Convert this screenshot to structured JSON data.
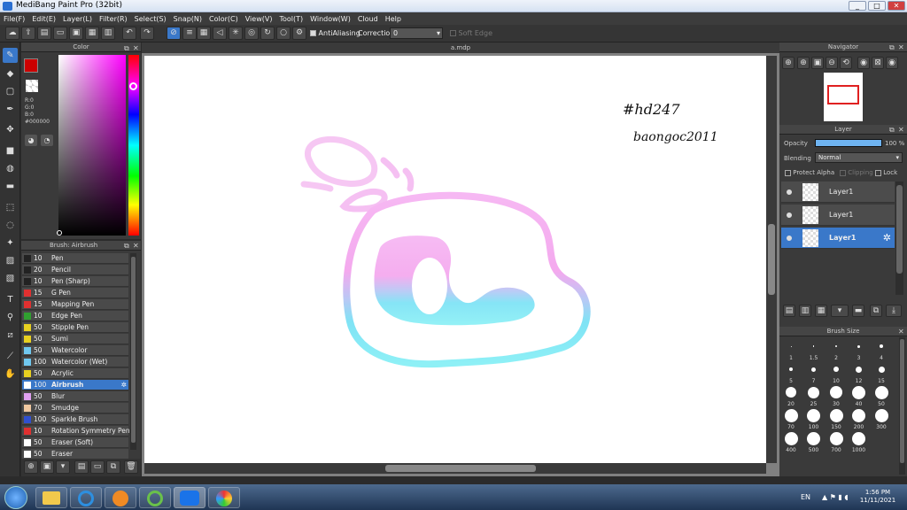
{
  "window": {
    "title": "MediBang Paint Pro (32bit)",
    "min": "_",
    "max": "□",
    "close": "✕"
  },
  "menu": [
    "File(F)",
    "Edit(E)",
    "Layer(L)",
    "Filter(R)",
    "Select(S)",
    "Snap(N)",
    "Color(C)",
    "View(V)",
    "Tool(T)",
    "Window(W)",
    "Cloud",
    "Help"
  ],
  "toolbar": {
    "antialiasing_label": "AntiAliasing",
    "correction_label": "Correction",
    "correction_value": "0",
    "soft_edge_label": "Soft Edge"
  },
  "color_panel": {
    "title": "Color",
    "r": "R:0",
    "g": "G:0",
    "b": "B:0",
    "hex": "#000000",
    "fg": "#cc0000",
    "bg": "#f08080"
  },
  "brush_panel": {
    "title": "Brush: Airbrush",
    "items": [
      {
        "size": "10",
        "name": "Pen",
        "color": "#222222"
      },
      {
        "size": "20",
        "name": "Pencil",
        "color": "#222222"
      },
      {
        "size": "10",
        "name": "Pen (Sharp)",
        "color": "#222222"
      },
      {
        "size": "15",
        "name": "G Pen",
        "color": "#e03030"
      },
      {
        "size": "15",
        "name": "Mapping Pen",
        "color": "#e03030"
      },
      {
        "size": "10",
        "name": "Edge Pen",
        "color": "#30a030"
      },
      {
        "size": "50",
        "name": "Stipple Pen",
        "color": "#e8d020"
      },
      {
        "size": "50",
        "name": "Sumi",
        "color": "#e8d020"
      },
      {
        "size": "50",
        "name": "Watercolor",
        "color": "#70c8f0"
      },
      {
        "size": "100",
        "name": "Watercolor (Wet)",
        "color": "#70c8f0"
      },
      {
        "size": "50",
        "name": "Acrylic",
        "color": "#e8d020"
      },
      {
        "size": "100",
        "name": "Airbrush",
        "color": "#ffffff",
        "selected": true
      },
      {
        "size": "50",
        "name": "Blur",
        "color": "#e0a0f0"
      },
      {
        "size": "70",
        "name": "Smudge",
        "color": "#f0c8a0"
      },
      {
        "size": "100",
        "name": "Sparkle Brush",
        "color": "#3050d0"
      },
      {
        "size": "10",
        "name": "Rotation Symmetry Pen",
        "color": "#e03030"
      },
      {
        "size": "50",
        "name": "Eraser (Soft)",
        "color": "#ffffff"
      },
      {
        "size": "50",
        "name": "Eraser",
        "color": "#ffffff"
      }
    ]
  },
  "document": {
    "tab": "a.mdp",
    "text1": "#hd247",
    "text2": "baongoc2011",
    "glyph": "@"
  },
  "navigator": {
    "title": "Navigator"
  },
  "layer_panel": {
    "title": "Layer",
    "opacity_label": "Opacity",
    "opacity_value": "100 %",
    "opacity_fraction": 1.0,
    "blending_label": "Blending",
    "blending_value": "Normal",
    "protect_alpha": "Protect Alpha",
    "clipping": "Clipping",
    "lock": "Lock",
    "layers": [
      {
        "name": "Layer1",
        "selected": false
      },
      {
        "name": "Layer1",
        "selected": false
      },
      {
        "name": "Layer1",
        "selected": true
      }
    ]
  },
  "brush_size": {
    "title": "Brush Size",
    "sizes": [
      "1",
      "1.5",
      "2",
      "3",
      "4",
      "5",
      "7",
      "10",
      "12",
      "15",
      "20",
      "25",
      "30",
      "40",
      "50",
      "70",
      "100",
      "150",
      "200",
      "300",
      "400",
      "500",
      "700",
      "1000"
    ]
  },
  "taskbar": {
    "lang": "EN",
    "time": "1:56 PM",
    "date": "11/11/2021"
  }
}
